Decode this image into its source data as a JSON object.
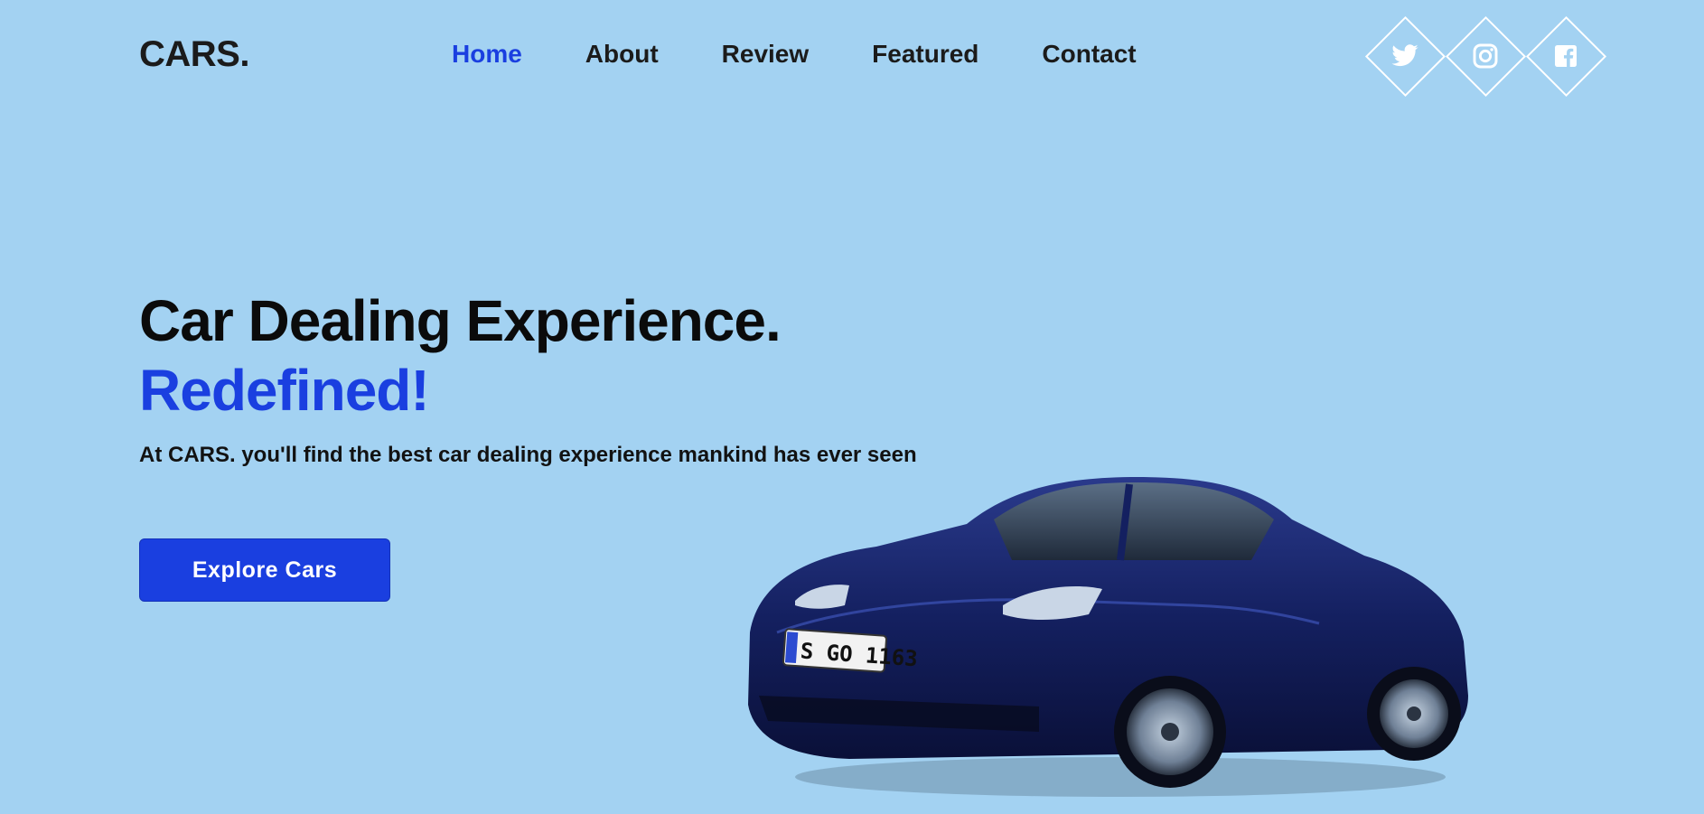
{
  "header": {
    "logo": "CARS.",
    "nav": [
      {
        "label": "Home",
        "active": true
      },
      {
        "label": "About",
        "active": false
      },
      {
        "label": "Review",
        "active": false
      },
      {
        "label": "Featured",
        "active": false
      },
      {
        "label": "Contact",
        "active": false
      }
    ],
    "socials": [
      {
        "icon": "twitter-icon"
      },
      {
        "icon": "instagram-icon"
      },
      {
        "icon": "facebook-icon"
      }
    ]
  },
  "hero": {
    "title": "Car Dealing Experience.",
    "accent": "Redefined!",
    "subtitle": "At CARS. you'll find the best car dealing experience mankind has ever seen",
    "cta_label": "Explore Cars",
    "car_plate": "S GO 1163"
  },
  "colors": {
    "background": "#a3d2f2",
    "accent": "#1a3fe0",
    "text": "#1b1b1b",
    "car_body": "#142060"
  }
}
